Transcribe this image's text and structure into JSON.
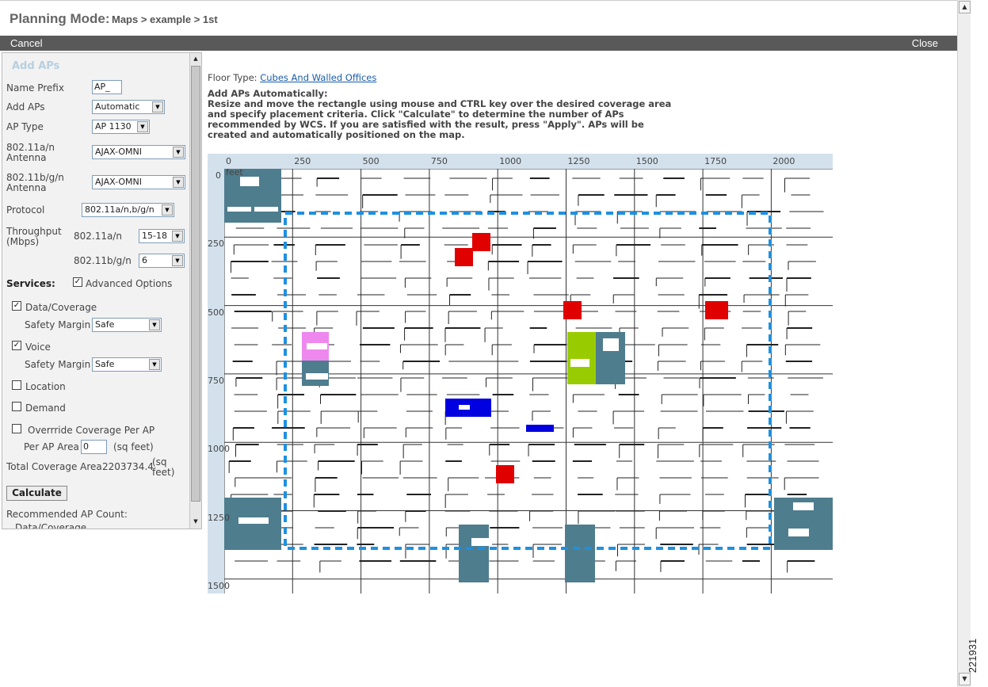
{
  "header": {
    "title": "Planning Mode:",
    "breadcrumb": "Maps > example > 1st"
  },
  "actions": {
    "cancel": "Cancel",
    "close": "Close"
  },
  "sidebar": {
    "section_title": "Add APs",
    "name_prefix_label": "Name Prefix",
    "name_prefix_value": "AP_",
    "add_aps_label": "Add APs",
    "add_aps_value": "Automatic",
    "ap_type_label": "AP Type",
    "ap_type_value": "AP 1130",
    "antenna_a_label_1": "802.11a/n",
    "antenna_a_label_2": "Antenna",
    "antenna_a_value": "AJAX-OMNI",
    "antenna_bg_label_1": "802.11b/g/n",
    "antenna_bg_label_2": "Antenna",
    "antenna_bg_value": "AJAX-OMNI",
    "protocol_label": "Protocol",
    "protocol_value": "802.11a/n,b/g/n",
    "throughput_label_1": "Throughput",
    "throughput_label_2": "(Mbps)",
    "throughput_a_label": "802.11a/n",
    "throughput_a_value": "15-18",
    "throughput_bg_label": "802.11b/g/n",
    "throughput_bg_value": "6",
    "services_label": "Services:",
    "advanced_label": "Advanced Options",
    "advanced_checked": true,
    "data_coverage_label": "Data/Coverage",
    "data_coverage_checked": true,
    "safety_margin_label": "Safety Margin",
    "data_safety_value": "Safe",
    "voice_label": "Voice",
    "voice_checked": true,
    "voice_safety_value": "Safe",
    "location_label": "Location",
    "demand_label": "Demand",
    "override_label": "Overrride Coverage Per AP",
    "per_ap_area_label": "Per AP Area",
    "per_ap_area_value": "0",
    "sq_feet_label": "(sq feet)",
    "total_coverage_label": "Total Coverage Area",
    "total_coverage_value": "2203734.4",
    "total_coverage_unit_1": "(sq",
    "total_coverage_unit_2": "feet)",
    "calculate_label": "Calculate",
    "recommended_label": "Recommended AP Count:",
    "recommended_sub": "Data/Coverage"
  },
  "main": {
    "floor_type_label": "Floor Type:",
    "floor_type_value": "Cubes And Walled Offices",
    "heading": "Add APs Automatically:",
    "line1": "Resize and move the rectangle using mouse and CTRL key over the desired coverage area",
    "line2": "and specify placement criteria. Click \"Calculate\" to determine the number of APs",
    "line3": "recommended by WCS. If you are satisfied with the result, press \"Apply\". APs will be",
    "line4": "created and automatically positioned on the map."
  },
  "map": {
    "x_ticks": [
      "0",
      "250",
      "500",
      "750",
      "1000",
      "1250",
      "1500",
      "1750",
      "2000"
    ],
    "y_ticks": [
      "0",
      "250",
      "500",
      "750",
      "1000",
      "1250",
      "1500"
    ],
    "unit": "feet",
    "selection_color": "#1e90e0",
    "ap_colors": {
      "red": "#e00000",
      "blue": "#0000e0",
      "green": "#99cc00",
      "pink": "#ee88ee",
      "teal": "#4e7d8e"
    }
  },
  "doc_id": "221931"
}
